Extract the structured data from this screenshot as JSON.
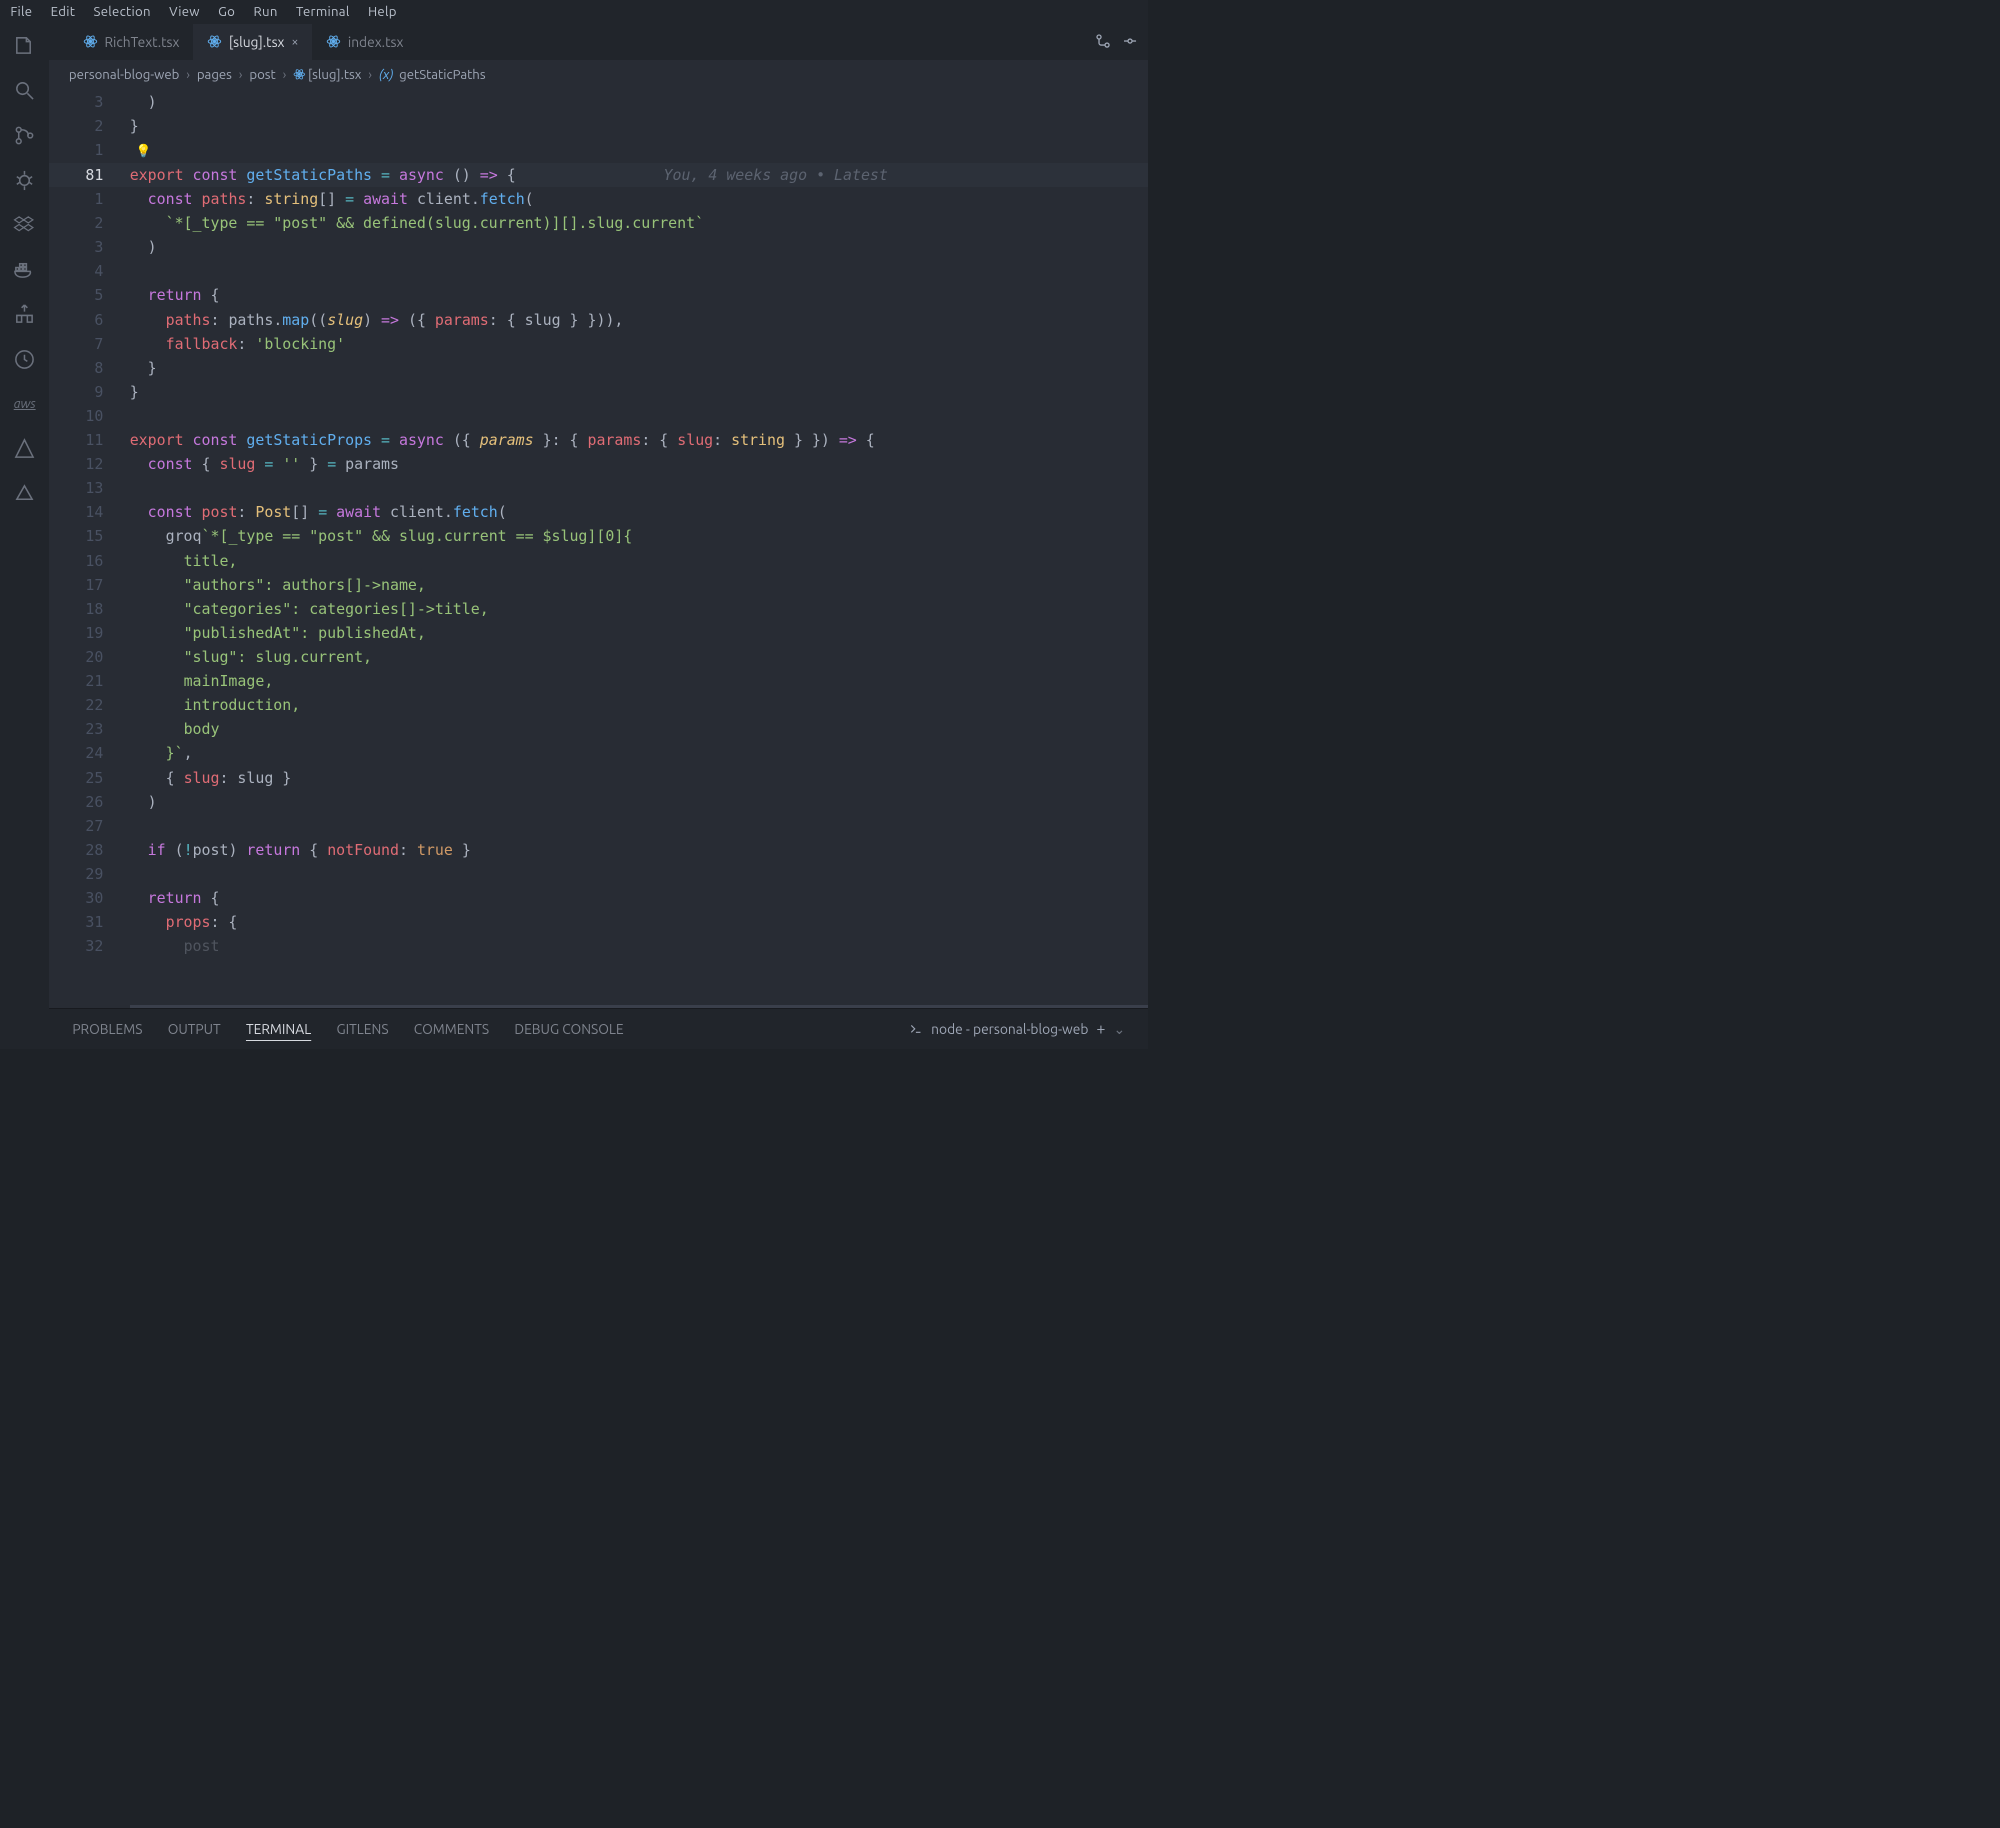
{
  "menubar": [
    "File",
    "Edit",
    "Selection",
    "View",
    "Go",
    "Run",
    "Terminal",
    "Help"
  ],
  "tabs": [
    {
      "label": "RichText.tsx",
      "active": false
    },
    {
      "label": "[slug].tsx",
      "active": true
    },
    {
      "label": "index.tsx",
      "active": false
    }
  ],
  "breadcrumbs": {
    "parts": [
      "personal-blog-web",
      "pages",
      "post"
    ],
    "file": "[slug].tsx",
    "symbol": "getStaticPaths",
    "symbolKind": "(x)"
  },
  "gitlens_annotation": "You, 4 weeks ago • Latest",
  "code": [
    {
      "n": "3",
      "indent": 1,
      "tokens": [
        [
          "punc",
          ")"
        ]
      ]
    },
    {
      "n": "2",
      "indent": 0,
      "tokens": [
        [
          "punc",
          "}"
        ]
      ]
    },
    {
      "n": "1",
      "indent": 0,
      "tokens": [],
      "lightbulb": true
    },
    {
      "n": "81",
      "indent": 0,
      "active": true,
      "hl": true,
      "anno": true,
      "tokens": [
        [
          "kw2",
          "export"
        ],
        [
          "",
          ""
        ],
        [
          "kw",
          " const "
        ],
        [
          "fn",
          "getStaticPaths"
        ],
        [
          "op",
          " = "
        ],
        [
          "kw",
          "async "
        ],
        [
          "punc",
          "() "
        ],
        [
          "kw",
          "=>"
        ],
        [
          "punc",
          " {"
        ]
      ]
    },
    {
      "n": "1",
      "indent": 1,
      "tokens": [
        [
          "kw",
          "const "
        ],
        [
          "prop",
          "paths"
        ],
        [
          "punc",
          ": "
        ],
        [
          "type",
          "string"
        ],
        [
          "punc",
          "[] "
        ],
        [
          "op",
          "= "
        ],
        [
          "kw",
          "await "
        ],
        [
          "var",
          "client"
        ],
        [
          "punc",
          "."
        ],
        [
          "fn",
          "fetch"
        ],
        [
          "punc",
          "("
        ]
      ]
    },
    {
      "n": "2",
      "indent": 2,
      "tokens": [
        [
          "str",
          "`*[_type == \"post\" && defined(slug.current)][].slug.current`"
        ]
      ]
    },
    {
      "n": "3",
      "indent": 1,
      "tokens": [
        [
          "punc",
          ")"
        ]
      ]
    },
    {
      "n": "4",
      "indent": 0,
      "tokens": []
    },
    {
      "n": "5",
      "indent": 1,
      "tokens": [
        [
          "kw",
          "return "
        ],
        [
          "punc",
          "{"
        ]
      ]
    },
    {
      "n": "6",
      "indent": 2,
      "tokens": [
        [
          "prop",
          "paths"
        ],
        [
          "punc",
          ": "
        ],
        [
          "var",
          "paths"
        ],
        [
          "punc",
          "."
        ],
        [
          "fn",
          "map"
        ],
        [
          "punc",
          "(("
        ],
        [
          "param",
          "slug"
        ],
        [
          "punc",
          ") "
        ],
        [
          "kw",
          "=>"
        ],
        [
          "punc",
          " ({ "
        ],
        [
          "prop",
          "params"
        ],
        [
          "punc",
          ": { "
        ],
        [
          "var",
          "slug"
        ],
        [
          "punc",
          " } })),"
        ]
      ]
    },
    {
      "n": "7",
      "indent": 2,
      "tokens": [
        [
          "prop",
          "fallback"
        ],
        [
          "punc",
          ": "
        ],
        [
          "str",
          "'blocking'"
        ]
      ]
    },
    {
      "n": "8",
      "indent": 1,
      "tokens": [
        [
          "punc",
          "}"
        ]
      ]
    },
    {
      "n": "9",
      "indent": 0,
      "tokens": [
        [
          "punc",
          "}"
        ]
      ]
    },
    {
      "n": "10",
      "indent": 0,
      "tokens": []
    },
    {
      "n": "11",
      "indent": 0,
      "tokens": [
        [
          "kw2",
          "export"
        ],
        [
          "kw",
          " const "
        ],
        [
          "fn",
          "getStaticProps"
        ],
        [
          "op",
          " = "
        ],
        [
          "kw",
          "async "
        ],
        [
          "punc",
          "({ "
        ],
        [
          "param",
          "params"
        ],
        [
          "punc",
          " }: { "
        ],
        [
          "prop",
          "params"
        ],
        [
          "punc",
          ": { "
        ],
        [
          "prop",
          "slug"
        ],
        [
          "punc",
          ": "
        ],
        [
          "type",
          "string"
        ],
        [
          "punc",
          " } }) "
        ],
        [
          "kw",
          "=>"
        ],
        [
          "punc",
          " {"
        ]
      ]
    },
    {
      "n": "12",
      "indent": 1,
      "tokens": [
        [
          "kw",
          "const "
        ],
        [
          "punc",
          "{ "
        ],
        [
          "prop",
          "slug"
        ],
        [
          "op",
          " = "
        ],
        [
          "str",
          "''"
        ],
        [
          "punc",
          " } "
        ],
        [
          "op",
          "= "
        ],
        [
          "var",
          "params"
        ]
      ]
    },
    {
      "n": "13",
      "indent": 0,
      "tokens": []
    },
    {
      "n": "14",
      "indent": 1,
      "tokens": [
        [
          "kw",
          "const "
        ],
        [
          "prop",
          "post"
        ],
        [
          "punc",
          ": "
        ],
        [
          "type",
          "Post"
        ],
        [
          "punc",
          "[] "
        ],
        [
          "op",
          "= "
        ],
        [
          "kw",
          "await "
        ],
        [
          "var",
          "client"
        ],
        [
          "punc",
          "."
        ],
        [
          "fn",
          "fetch"
        ],
        [
          "punc",
          "("
        ]
      ]
    },
    {
      "n": "15",
      "indent": 2,
      "tokens": [
        [
          "var",
          "groq"
        ],
        [
          "str",
          "`*[_type == \"post\" && slug.current == $slug][0]{"
        ]
      ]
    },
    {
      "n": "16",
      "indent": 3,
      "tokens": [
        [
          "str",
          "title,"
        ]
      ]
    },
    {
      "n": "17",
      "indent": 3,
      "tokens": [
        [
          "str",
          "\"authors\": authors[]->name,"
        ]
      ]
    },
    {
      "n": "18",
      "indent": 3,
      "tokens": [
        [
          "str",
          "\"categories\": categories[]->title,"
        ]
      ]
    },
    {
      "n": "19",
      "indent": 3,
      "tokens": [
        [
          "str",
          "\"publishedAt\": publishedAt,"
        ]
      ]
    },
    {
      "n": "20",
      "indent": 3,
      "tokens": [
        [
          "str",
          "\"slug\": slug.current,"
        ]
      ]
    },
    {
      "n": "21",
      "indent": 3,
      "tokens": [
        [
          "str",
          "mainImage,"
        ]
      ]
    },
    {
      "n": "22",
      "indent": 3,
      "tokens": [
        [
          "str",
          "introduction,"
        ]
      ]
    },
    {
      "n": "23",
      "indent": 3,
      "tokens": [
        [
          "str",
          "body"
        ]
      ]
    },
    {
      "n": "24",
      "indent": 2,
      "tokens": [
        [
          "str",
          "}`"
        ],
        [
          "punc",
          ","
        ]
      ]
    },
    {
      "n": "25",
      "indent": 2,
      "tokens": [
        [
          "punc",
          "{ "
        ],
        [
          "prop",
          "slug"
        ],
        [
          "punc",
          ": "
        ],
        [
          "var",
          "slug"
        ],
        [
          "punc",
          " }"
        ]
      ]
    },
    {
      "n": "26",
      "indent": 1,
      "tokens": [
        [
          "punc",
          ")"
        ]
      ]
    },
    {
      "n": "27",
      "indent": 0,
      "tokens": []
    },
    {
      "n": "28",
      "indent": 1,
      "tokens": [
        [
          "kw",
          "if "
        ],
        [
          "punc",
          "("
        ],
        [
          "op",
          "!"
        ],
        [
          "var",
          "post"
        ],
        [
          "punc",
          ") "
        ],
        [
          "kw",
          "return "
        ],
        [
          "punc",
          "{ "
        ],
        [
          "prop",
          "notFound"
        ],
        [
          "punc",
          ": "
        ],
        [
          "num",
          "true"
        ],
        [
          "punc",
          " }"
        ]
      ]
    },
    {
      "n": "29",
      "indent": 0,
      "tokens": []
    },
    {
      "n": "30",
      "indent": 1,
      "tokens": [
        [
          "kw",
          "return "
        ],
        [
          "punc",
          "{"
        ]
      ]
    },
    {
      "n": "31",
      "indent": 2,
      "tokens": [
        [
          "prop",
          "props"
        ],
        [
          "punc",
          ": {"
        ]
      ]
    },
    {
      "n": "32",
      "indent": 3,
      "tokens": [
        [
          "var",
          "post"
        ]
      ],
      "cut": true
    }
  ],
  "panel": {
    "tabs": [
      "PROBLEMS",
      "OUTPUT",
      "TERMINAL",
      "GITLENS",
      "COMMENTS",
      "DEBUG CONSOLE"
    ],
    "active": "TERMINAL",
    "terminal_label": "node - personal-blog-web"
  },
  "activity_icons": [
    "files",
    "search",
    "git",
    "debug",
    "dropbox",
    "docker",
    "extensions",
    "live",
    "aws",
    "azure",
    "deploy"
  ]
}
